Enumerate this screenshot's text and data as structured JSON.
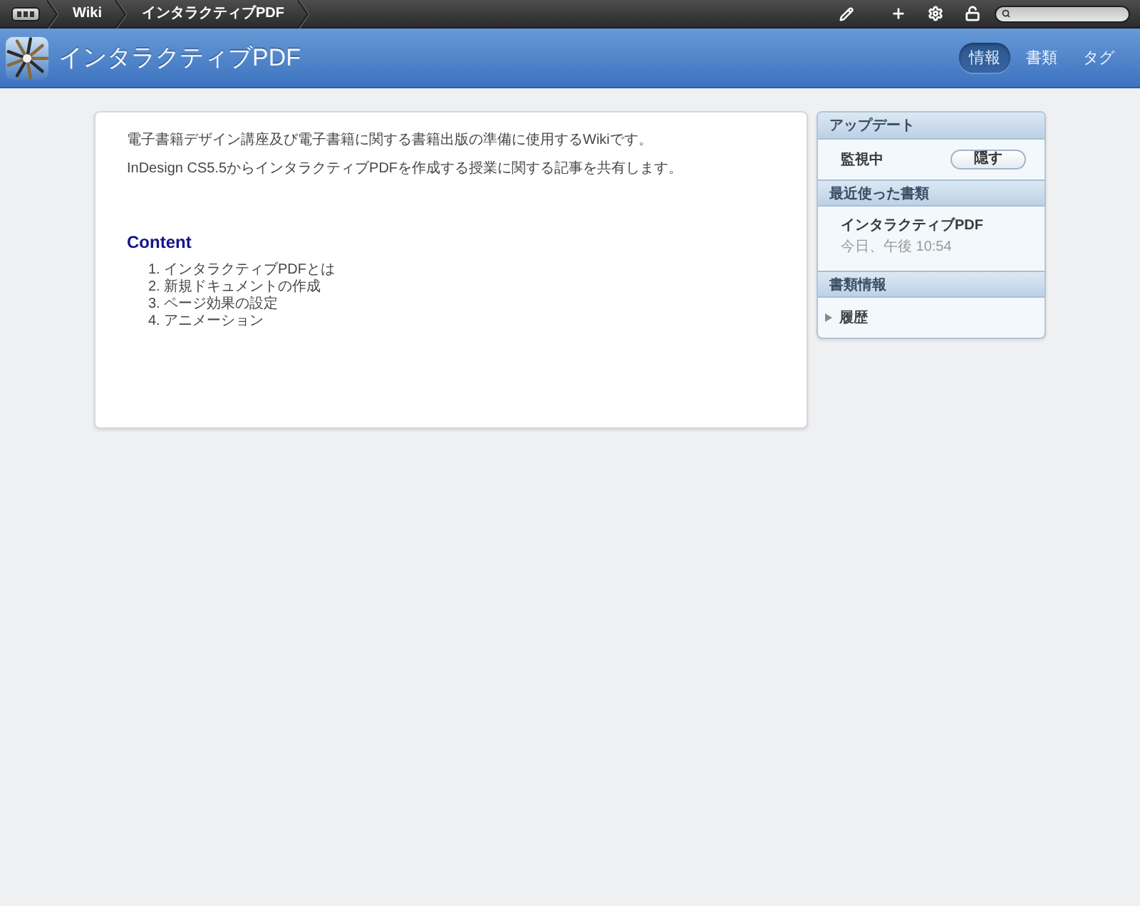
{
  "toolbar": {
    "breadcrumb": [
      {
        "label": "Wiki"
      },
      {
        "label": "インタラクティブPDF"
      }
    ]
  },
  "header": {
    "title": "インタラクティブPDF",
    "tabs": [
      {
        "label": "情報",
        "selected": true
      },
      {
        "label": "書類",
        "selected": false
      },
      {
        "label": "タグ",
        "selected": false
      }
    ]
  },
  "article": {
    "paragraphs": [
      "電子書籍デザイン講座及び電子書籍に関する書籍出版の準備に使用するWikiです。",
      "InDesign CS5.5からインタラクティブPDFを作成する授業に関する記事を共有します。"
    ],
    "heading": "Content",
    "list": [
      {
        "number": "1.",
        "text": "インタラクティブPDFとは"
      },
      {
        "number": "2.",
        "text": "新規ドキュメントの作成"
      },
      {
        "number": "3.",
        "text": "ページ効果の設定"
      },
      {
        "number": "4.",
        "text": "アニメーション"
      }
    ]
  },
  "sidebar": {
    "sections": [
      {
        "kind": "watch",
        "title": "アップデート",
        "label": "監視中",
        "button": "隠す"
      },
      {
        "kind": "recent",
        "title": "最近使った書類",
        "items": [
          {
            "name": "インタラクティブPDF",
            "time": "今日、午後 10:54"
          }
        ]
      },
      {
        "kind": "disclosure",
        "title": "書類情報",
        "items": [
          {
            "label": "履歴",
            "expanded": false
          }
        ]
      }
    ]
  }
}
